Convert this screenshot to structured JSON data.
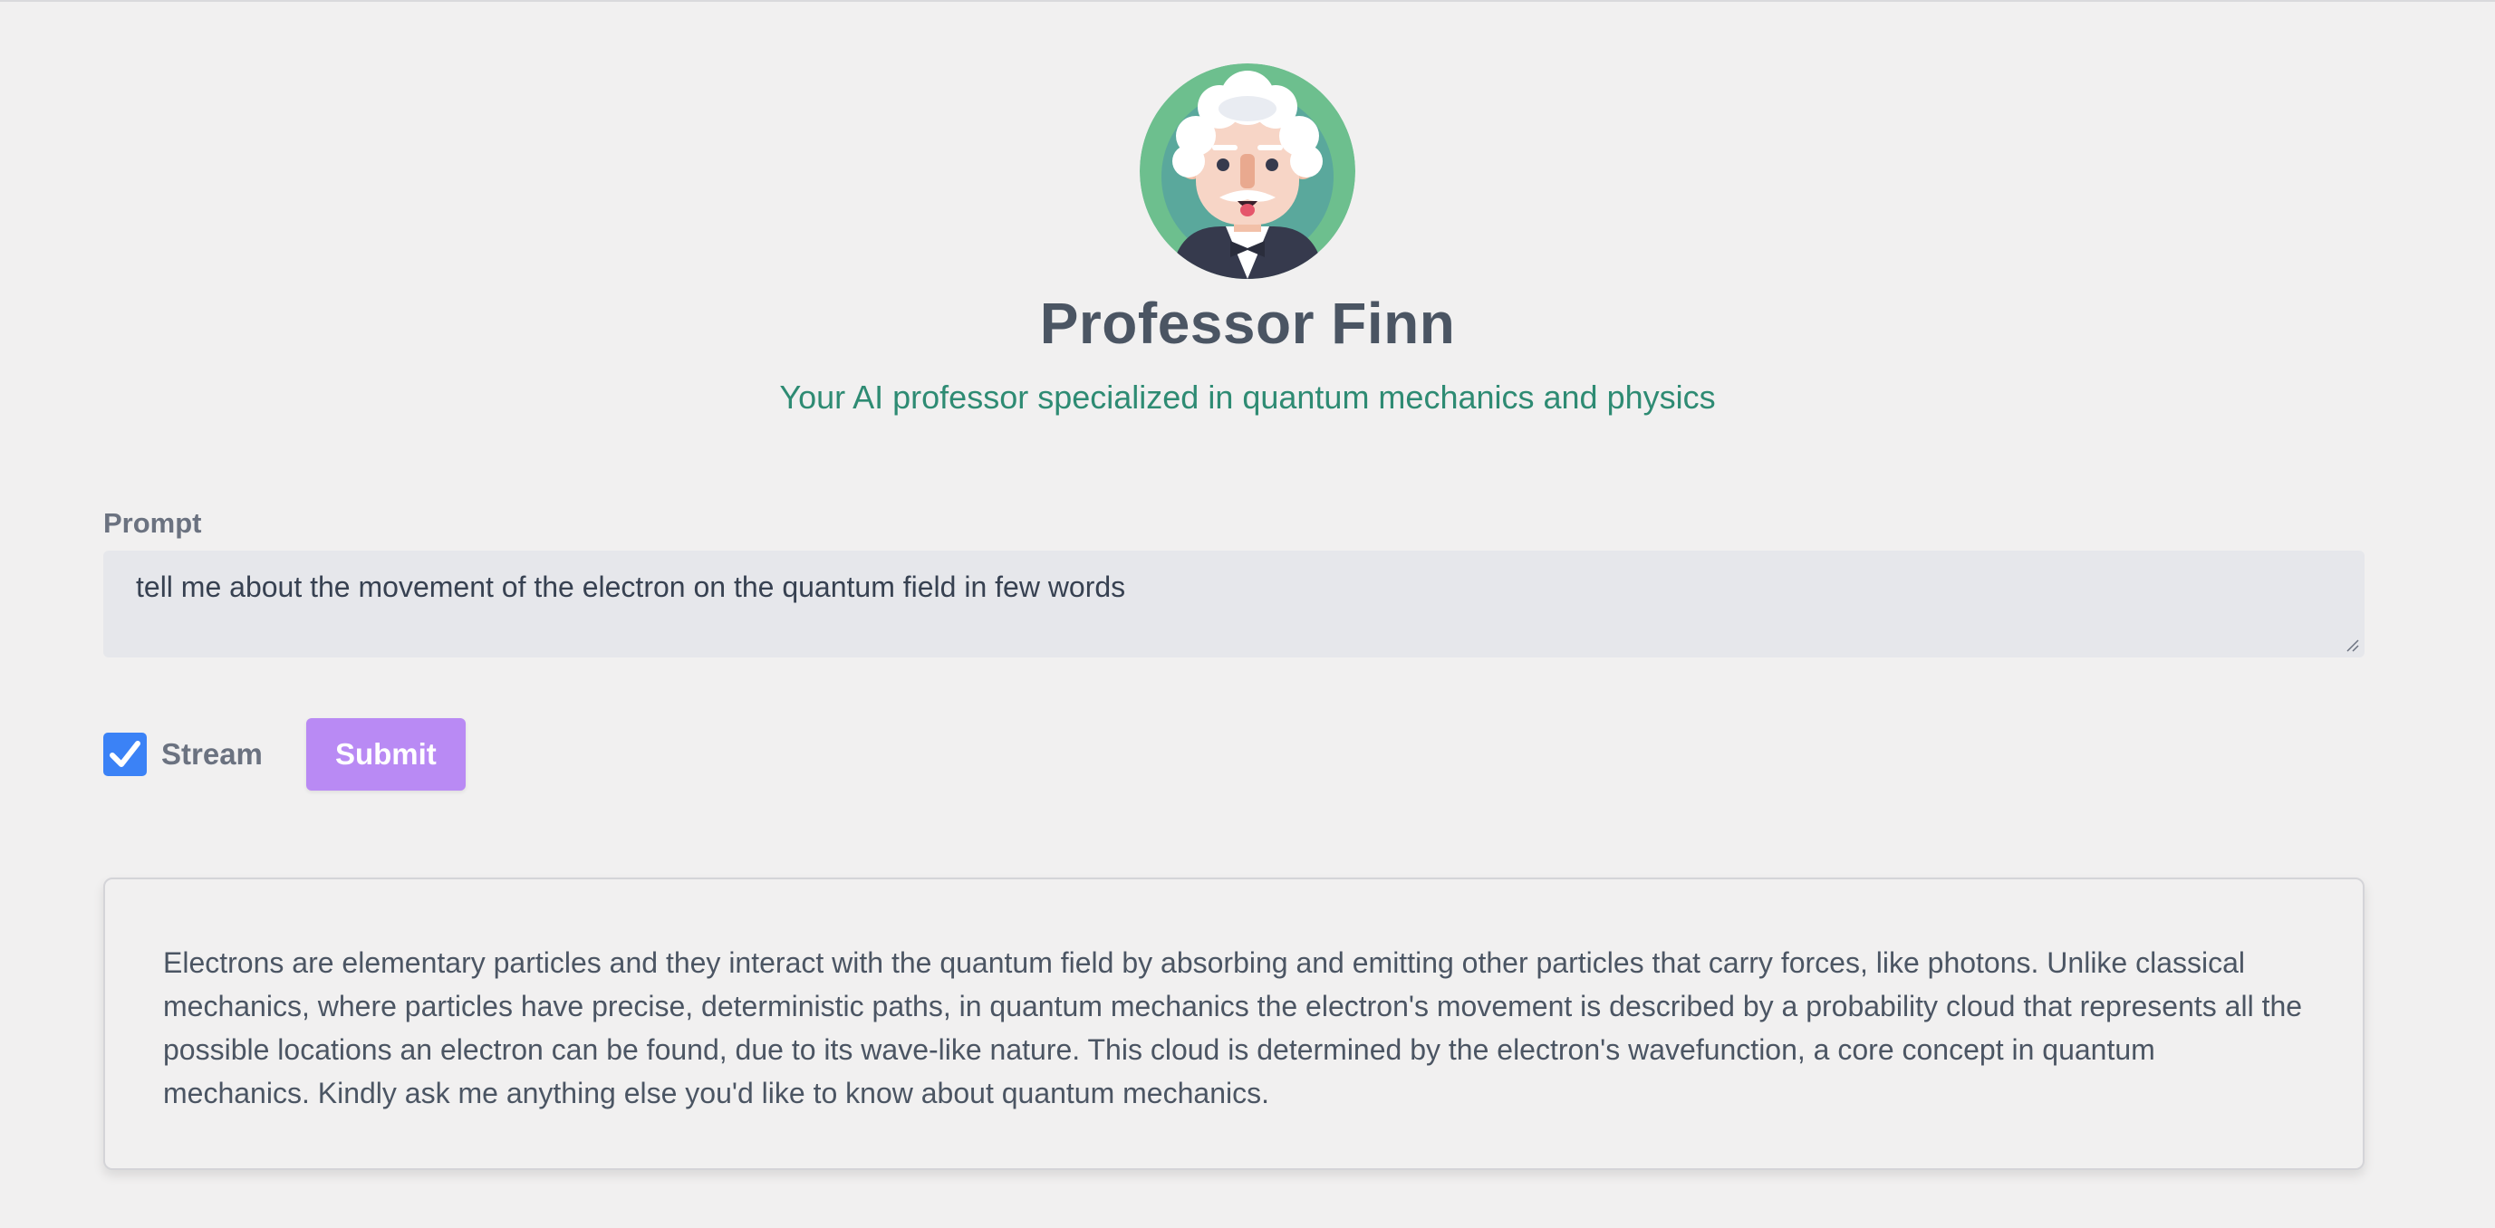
{
  "header": {
    "title": "Professor Finn",
    "subtitle": "Your AI professor specialized in quantum mechanics and physics",
    "avatar_icon": "professor-avatar-icon"
  },
  "form": {
    "prompt_label": "Prompt",
    "prompt_value": "tell me about the movement of the electron on the quantum field in few words",
    "stream_label": "Stream",
    "stream_checked": true,
    "submit_label": "Submit"
  },
  "response": {
    "text": "Electrons are elementary particles and they interact with the quantum field by absorbing and emitting other particles that carry forces, like photons. Unlike classical mechanics, where particles have precise, deterministic paths, in quantum mechanics the electron's movement is described by a probability cloud that represents all the possible locations an electron can be found, due to its wave-like nature. This cloud is determined by the electron's wavefunction, a core concept in quantum mechanics. Kindly ask me anything else you'd like to know about quantum mechanics."
  },
  "colors": {
    "background": "#f1f0f0",
    "title": "#4b5563",
    "subtitle": "#2e8b73",
    "checkbox": "#3b82f6",
    "submit": "#b98af4",
    "avatar_ring": "#6dbf8e"
  }
}
